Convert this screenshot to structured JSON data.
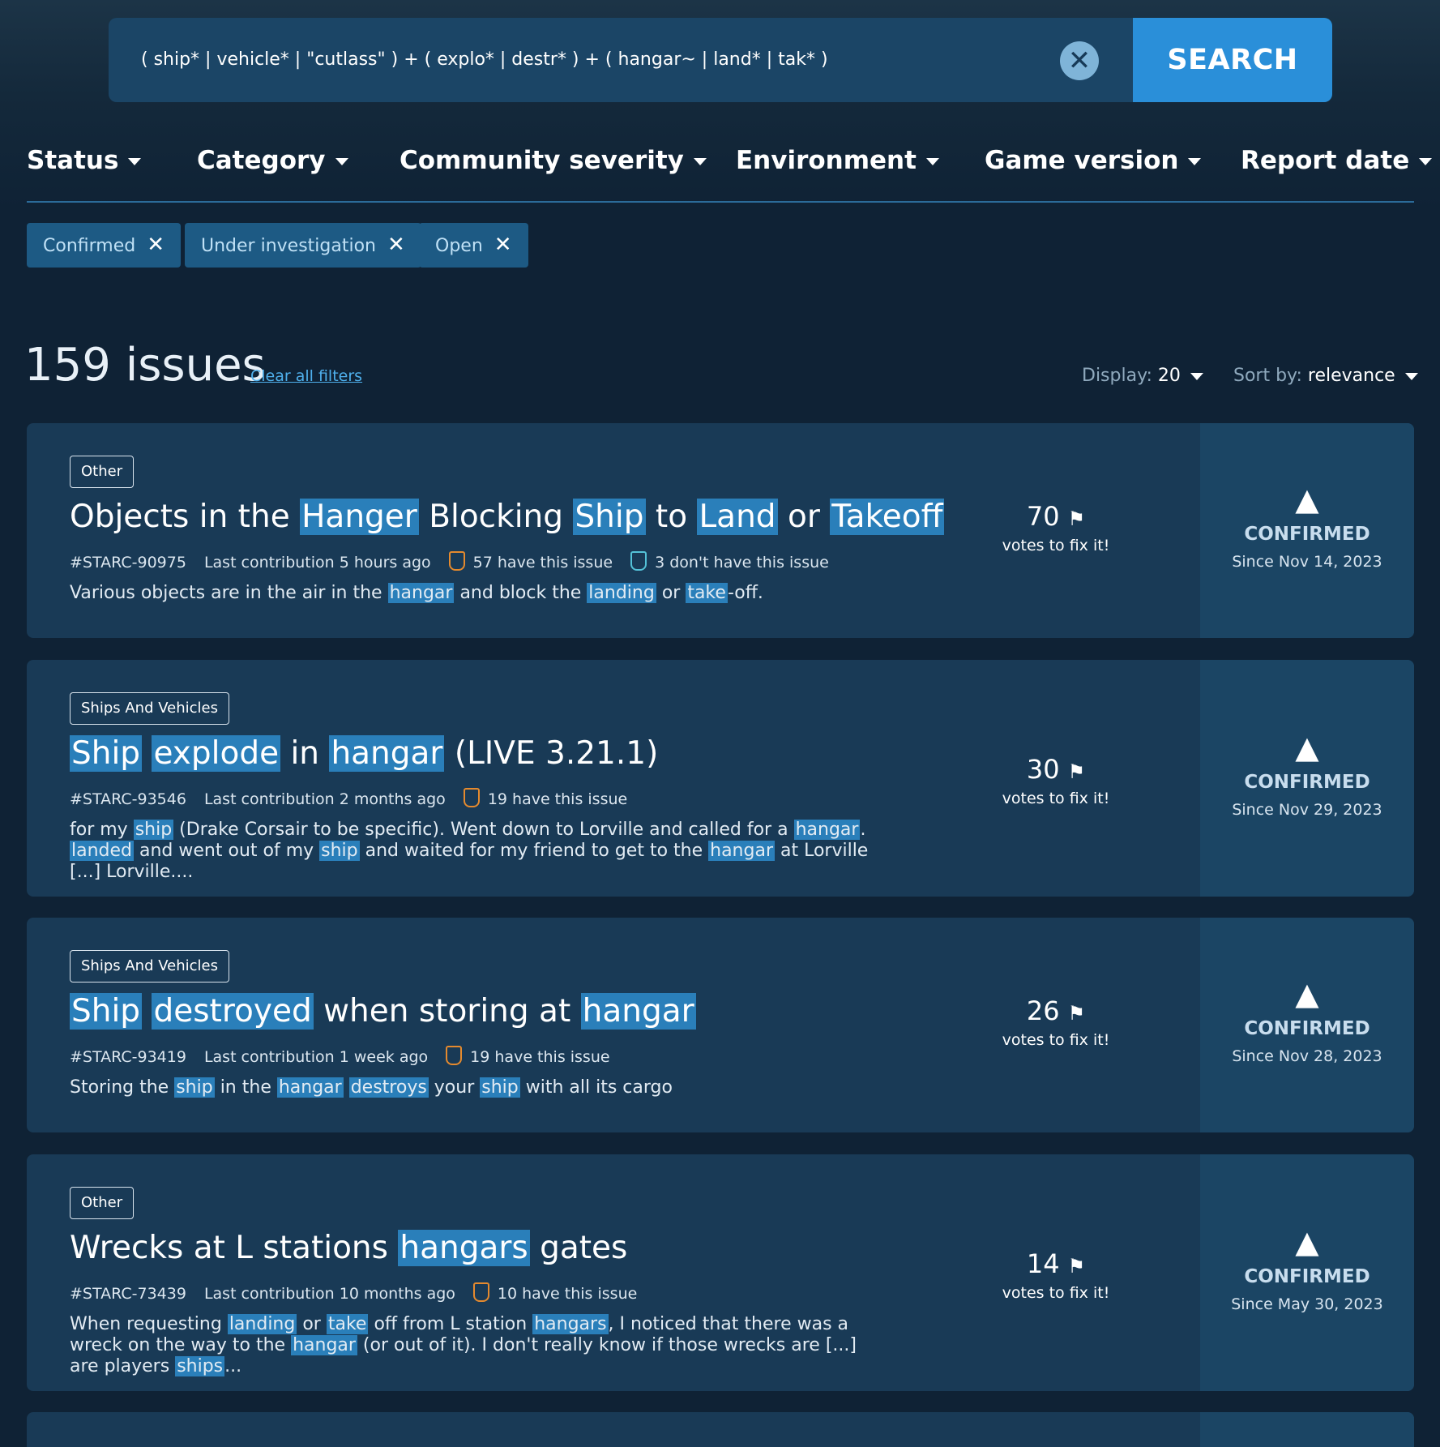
{
  "search": {
    "query": "( ship* | vehicle* | \"cutlass\" ) + ( explo* | destr* ) + ( hangar~ | land* | tak* )",
    "clear_icon": "✕",
    "button_label": "SEARCH"
  },
  "filters": [
    {
      "label": "Status"
    },
    {
      "label": "Category"
    },
    {
      "label": "Community severity"
    },
    {
      "label": "Environment"
    },
    {
      "label": "Game version"
    },
    {
      "label": "Report date"
    }
  ],
  "active_chips": [
    {
      "label": "Confirmed",
      "remove": "✕"
    },
    {
      "label": "Under investigation",
      "remove": "✕"
    },
    {
      "label": "Open",
      "remove": "✕"
    }
  ],
  "results": {
    "count_text": "159 issues",
    "clear_link": "Clear all filters",
    "display_label": "Display:",
    "display_value": "20",
    "sort_label": "Sort by:",
    "sort_value": "relevance"
  },
  "issues": [
    {
      "category": "Other",
      "title_parts": [
        [
          "Objects in the ",
          0
        ],
        [
          "Hanger",
          1
        ],
        [
          " Blocking ",
          0
        ],
        [
          "Ship",
          1
        ],
        [
          " to ",
          0
        ],
        [
          "Land",
          1
        ],
        [
          " or ",
          0
        ],
        [
          "Takeoff",
          1
        ]
      ],
      "id": "#STARC-90975",
      "last_contribution": "Last contribution 5 hours ago",
      "have": "57 have this issue",
      "dont_have": "3 don't have this issue",
      "desc_parts": [
        [
          "Various objects are in the air in the ",
          0
        ],
        [
          "hangar",
          1
        ],
        [
          " and block the ",
          0
        ],
        [
          "landing",
          1
        ],
        [
          " or ",
          0
        ],
        [
          "take",
          1
        ],
        [
          "-off.",
          0
        ]
      ],
      "votes": "70",
      "votes_label": "votes to fix it!",
      "status": "CONFIRMED",
      "since": "Since Nov 14, 2023"
    },
    {
      "category": "Ships And Vehicles",
      "title_parts": [
        [
          "Ship",
          1
        ],
        [
          " ",
          0
        ],
        [
          "explode",
          1
        ],
        [
          " in ",
          0
        ],
        [
          "hangar",
          1
        ],
        [
          " (LIVE 3.21.1)",
          0
        ]
      ],
      "id": "#STARC-93546",
      "last_contribution": "Last contribution 2 months ago",
      "have": "19 have this issue",
      "dont_have": "",
      "desc_parts": [
        [
          "for my ",
          0
        ],
        [
          "ship",
          1
        ],
        [
          " (Drake Corsair to be specific). Went down to Lorville and called for a ",
          0
        ],
        [
          "hangar",
          1
        ],
        [
          ". ",
          0
        ],
        [
          "landed",
          1
        ],
        [
          " and went out of my ",
          0
        ],
        [
          "ship",
          1
        ],
        [
          " and waited for my friend to get to the ",
          0
        ],
        [
          "hangar",
          1
        ],
        [
          " at Lorville [...] Lorville....",
          0
        ]
      ],
      "votes": "30",
      "votes_label": "votes to fix it!",
      "status": "CONFIRMED",
      "since": "Since Nov 29, 2023"
    },
    {
      "category": "Ships And Vehicles",
      "title_parts": [
        [
          "Ship",
          1
        ],
        [
          " ",
          0
        ],
        [
          "destroyed",
          1
        ],
        [
          " when storing at ",
          0
        ],
        [
          "hangar",
          1
        ]
      ],
      "id": "#STARC-93419",
      "last_contribution": "Last contribution 1 week ago",
      "have": "19 have this issue",
      "dont_have": "",
      "desc_parts": [
        [
          "Storing the ",
          0
        ],
        [
          "ship",
          1
        ],
        [
          " in the ",
          0
        ],
        [
          "hangar",
          1
        ],
        [
          " ",
          0
        ],
        [
          "destroys",
          1
        ],
        [
          " your ",
          0
        ],
        [
          "ship",
          1
        ],
        [
          " with all its cargo",
          0
        ]
      ],
      "votes": "26",
      "votes_label": "votes to fix it!",
      "status": "CONFIRMED",
      "since": "Since Nov 28, 2023"
    },
    {
      "category": "Other",
      "title_parts": [
        [
          "Wrecks at L stations ",
          0
        ],
        [
          "hangars",
          1
        ],
        [
          " gates",
          0
        ]
      ],
      "id": "#STARC-73439",
      "last_contribution": "Last contribution 10 months ago",
      "have": "10 have this issue",
      "dont_have": "",
      "desc_parts": [
        [
          "When requesting ",
          0
        ],
        [
          "landing",
          1
        ],
        [
          " or ",
          0
        ],
        [
          "take",
          1
        ],
        [
          " off from L station ",
          0
        ],
        [
          "hangars",
          1
        ],
        [
          ", I noticed that there was a wreck on the way to the ",
          0
        ],
        [
          "hangar",
          1
        ],
        [
          " (or out of it). I don't really know if those wrecks are [...] are players ",
          0
        ],
        [
          "ships",
          1
        ],
        [
          "...",
          0
        ]
      ],
      "votes": "14",
      "votes_label": "votes to fix it!",
      "status": "CONFIRMED",
      "since": "Since May 30, 2023"
    }
  ],
  "icons": {
    "vote": "flag-icon",
    "status": "ship-icon",
    "clear": "close-icon"
  },
  "colors": {
    "accent": "#2a8fd9",
    "highlight": "#2a7fba",
    "card": "#193a56"
  }
}
